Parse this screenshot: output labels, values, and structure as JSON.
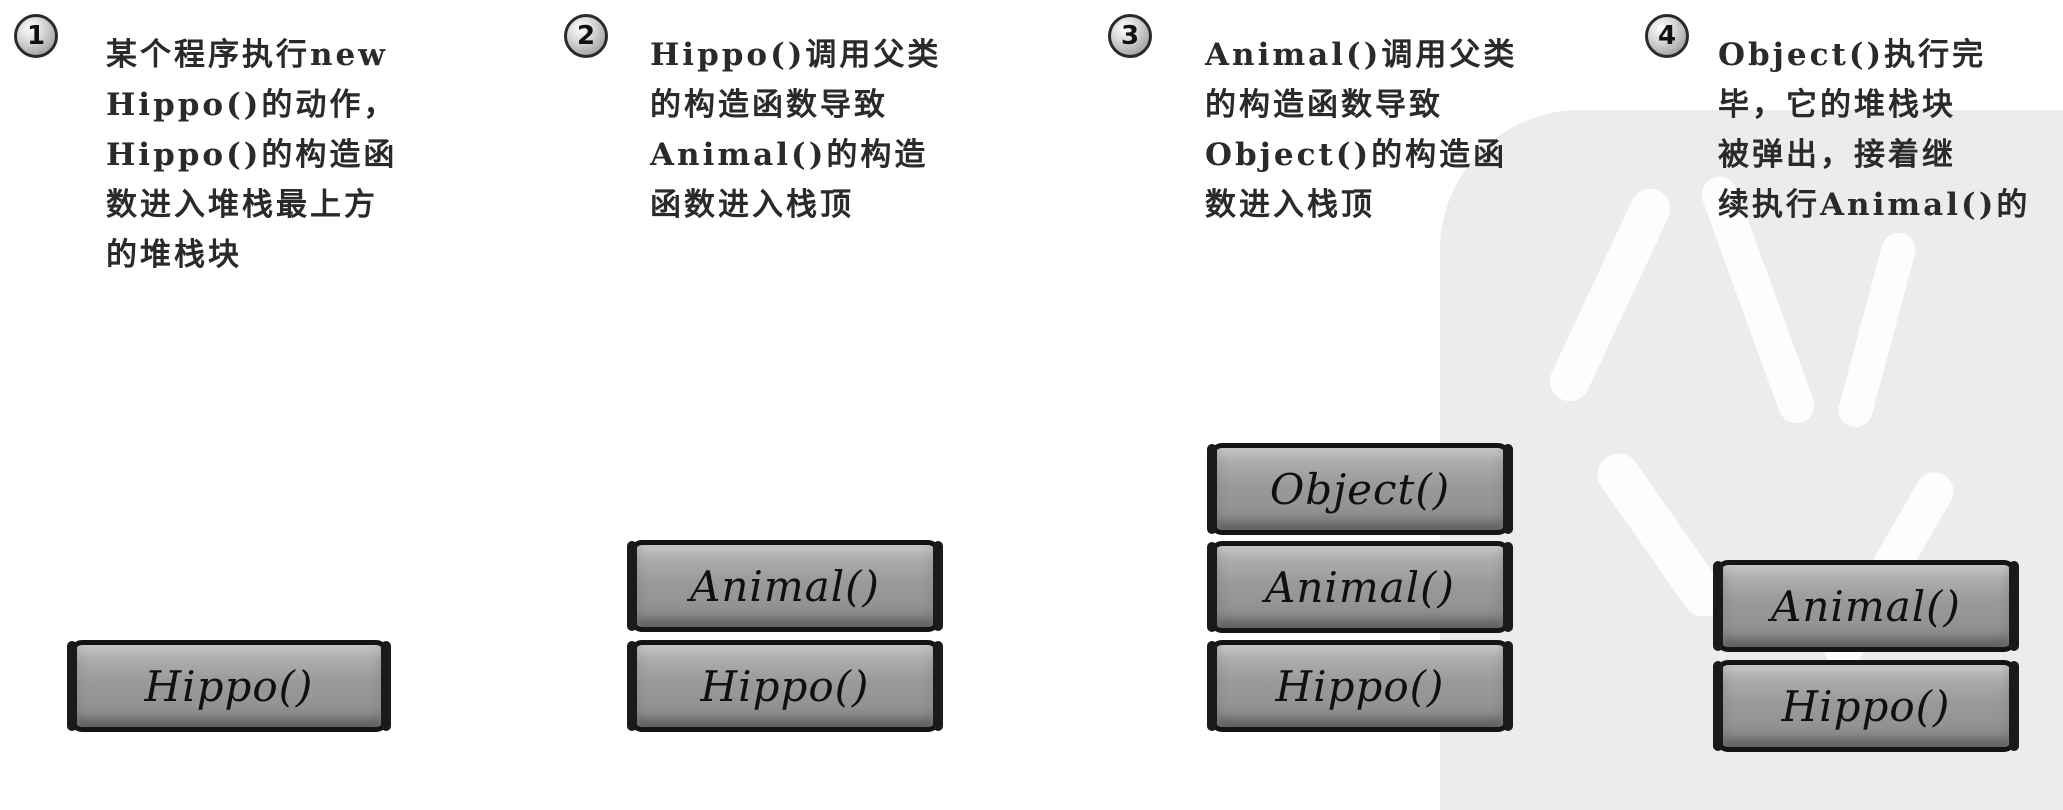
{
  "steps": [
    {
      "number": "1",
      "lines": [
        "某个程序执行new",
        "Hippo()的动作，",
        "Hippo()的构造函",
        "数进入堆栈最上方",
        "的堆栈块"
      ],
      "stack": [
        "Hippo()"
      ]
    },
    {
      "number": "2",
      "lines": [
        "Hippo()调用父类",
        "的构造函数导致",
        "Animal()的构造",
        "函数进入栈顶"
      ],
      "stack": [
        "Animal()",
        "Hippo()"
      ]
    },
    {
      "number": "3",
      "lines": [
        "Animal()调用父类",
        "的构造函数导致",
        "Object()的构造函",
        "数进入栈顶"
      ],
      "stack": [
        "Object()",
        "Animal()",
        "Hippo()"
      ]
    },
    {
      "number": "4",
      "lines": [
        "Object()执行完",
        "毕，它的堆栈块",
        "被弹出，接着继",
        "续执行Animal()的"
      ],
      "stack": [
        "Animal()",
        "Hippo()"
      ]
    }
  ]
}
